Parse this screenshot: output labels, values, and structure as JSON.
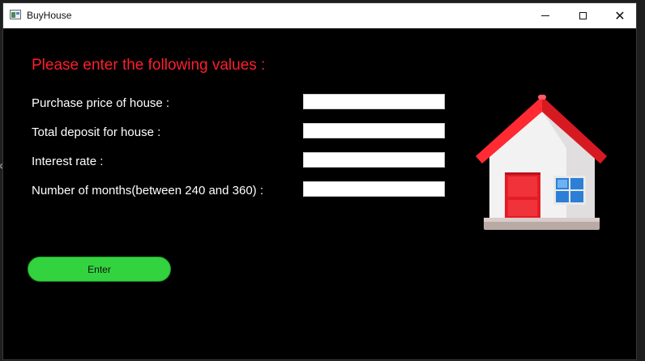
{
  "window": {
    "title": "BuyHouse",
    "controls": {
      "minimize_icon": "minimize-icon",
      "maximize_icon": "maximize-icon",
      "close_icon": "close-icon",
      "close_glyph": "✕"
    }
  },
  "form": {
    "heading": "Please enter the following values :",
    "heading_color": "#ff1e2d",
    "fields": [
      {
        "label": "Purchase price of house :",
        "value": ""
      },
      {
        "label": "Total deposit for house :",
        "value": ""
      },
      {
        "label": "Interest rate :",
        "value": ""
      },
      {
        "label": "Number of months(between 240 and 360) :",
        "value": ""
      }
    ],
    "enter_button": "Enter",
    "enter_button_color": "#33d23f"
  },
  "image": {
    "icon": "house-icon"
  },
  "background_color": "#000000"
}
